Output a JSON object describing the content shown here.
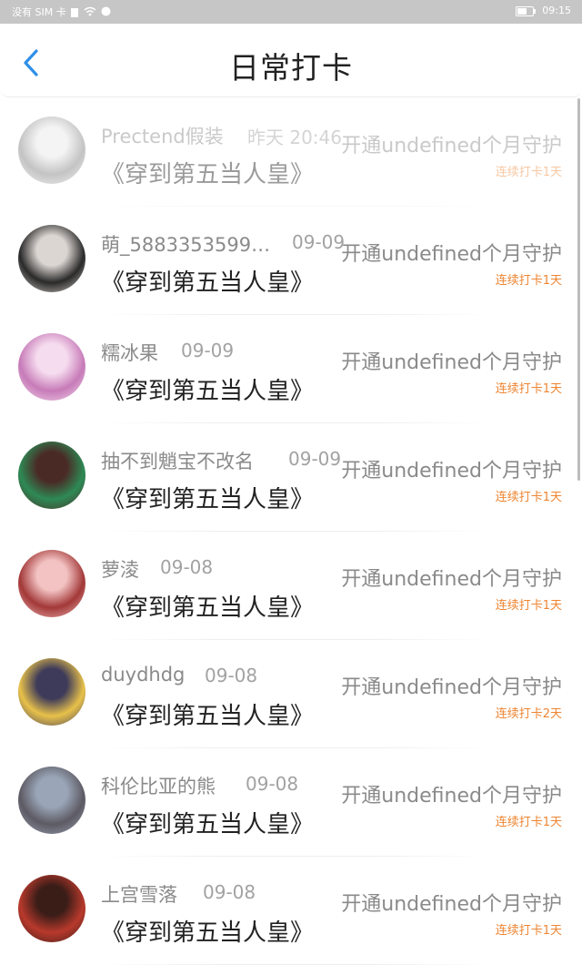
{
  "status_bar": {
    "sim_text": "没有 SIM 卡",
    "time": "09:15"
  },
  "header": {
    "title": "日常打卡"
  },
  "checkins": [
    {
      "user": "Prectend假装",
      "time": "昨天 20:46",
      "book": "《穿到第五当人皇》",
      "vip": "开通undefined个月守护",
      "streak": "连续打卡1天",
      "colors": [
        "#e7e7e7",
        "#7d7d7d"
      ]
    },
    {
      "user": "萌_5883353599…",
      "time": "09-09",
      "book": "《穿到第五当人皇》",
      "vip": "开通undefined个月守护",
      "streak": "连续打卡1天",
      "colors": [
        "#dcd6d2",
        "#2a2a2a"
      ]
    },
    {
      "user": "糯冰果",
      "time": "09-09",
      "book": "《穿到第五当人皇》",
      "vip": "开通undefined个月守护",
      "streak": "连续打卡1天",
      "colors": [
        "#f6dcef",
        "#c77bb8"
      ]
    },
    {
      "user": "抽不到魈宝不改名",
      "time": "09-09",
      "book": "《穿到第五当人皇》",
      "vip": "开通undefined个月守护",
      "streak": "连续打卡1天",
      "colors": [
        "#4a2a25",
        "#2e8a55"
      ]
    },
    {
      "user": "萝淩",
      "time": "09-08",
      "book": "《穿到第五当人皇》",
      "vip": "开通undefined个月守护",
      "streak": "连续打卡1天",
      "colors": [
        "#f3c2c2",
        "#a33838"
      ]
    },
    {
      "user": "duydhdg",
      "time": "09-08",
      "book": "《穿到第五当人皇》",
      "vip": "开通undefined个月守护",
      "streak": "连续打卡2天",
      "colors": [
        "#3d3a5a",
        "#e8c14a"
      ]
    },
    {
      "user": "科伦比亚的熊",
      "time": "09-08",
      "book": "《穿到第五当人皇》",
      "vip": "开通undefined个月守护",
      "streak": "连续打卡1天",
      "colors": [
        "#9aa6b8",
        "#5d5a63"
      ]
    },
    {
      "user": "上宫雪落",
      "time": "09-08",
      "book": "《穿到第五当人皇》",
      "vip": "开通undefined个月守护",
      "streak": "连续打卡1天",
      "colors": [
        "#3b1d18",
        "#b8392c"
      ]
    }
  ],
  "theme": {
    "accent": "#2f8fe8",
    "streak_color": "#ee8532"
  }
}
